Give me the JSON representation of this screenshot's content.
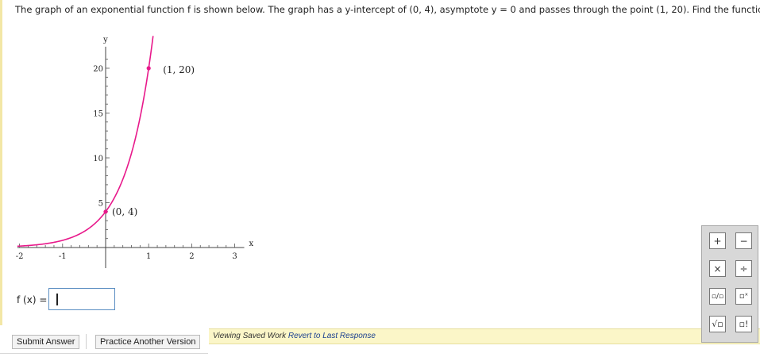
{
  "question": {
    "text": "The graph of an exponential function f is shown below. The graph has a y-intercept of (0, 4), asymptote y = 0 and passes through the point (1, 20). Find the function."
  },
  "graph": {
    "x_axis_label": "x",
    "y_axis_label": "y",
    "x_tick_labels": [
      "-2",
      "-1",
      "1",
      "2",
      "3"
    ],
    "y_tick_labels": [
      "5",
      "10",
      "15",
      "20"
    ],
    "point_labels": [
      "(0, 4)",
      "(1, 20)"
    ],
    "curve_color": "#e8198b"
  },
  "chart_data": {
    "type": "line",
    "title": "",
    "xlabel": "x",
    "ylabel": "y",
    "xlim": [
      -2,
      3
    ],
    "ylim": [
      0,
      20
    ],
    "x_ticks": [
      -2,
      -1,
      1,
      2,
      3
    ],
    "y_ticks": [
      5,
      10,
      15,
      20
    ],
    "function": "4 * 5^x",
    "series": [
      {
        "x": [
          -2,
          -1.5,
          -1,
          -0.5,
          0,
          0.25,
          0.5,
          0.75,
          1,
          1.1
        ],
        "y": [
          0.16,
          0.358,
          0.8,
          1.789,
          4,
          5.98,
          8.94,
          13.37,
          20,
          23.43
        ]
      }
    ],
    "labeled_points": [
      {
        "x": 0,
        "y": 4,
        "label": "(0, 4)"
      },
      {
        "x": 1,
        "y": 20,
        "label": "(1, 20)"
      }
    ]
  },
  "answer": {
    "label": "f (x) =",
    "value": ""
  },
  "buttons": {
    "submit": "Submit Answer",
    "practice": "Practice Another Version"
  },
  "saved_bar": {
    "text": "Viewing Saved Work",
    "link": "Revert to Last Response"
  },
  "keypad": {
    "keys": [
      "+",
      "−",
      "×",
      "÷",
      "▫/▫",
      "▫ˣ",
      "√▫",
      "▫!"
    ]
  }
}
